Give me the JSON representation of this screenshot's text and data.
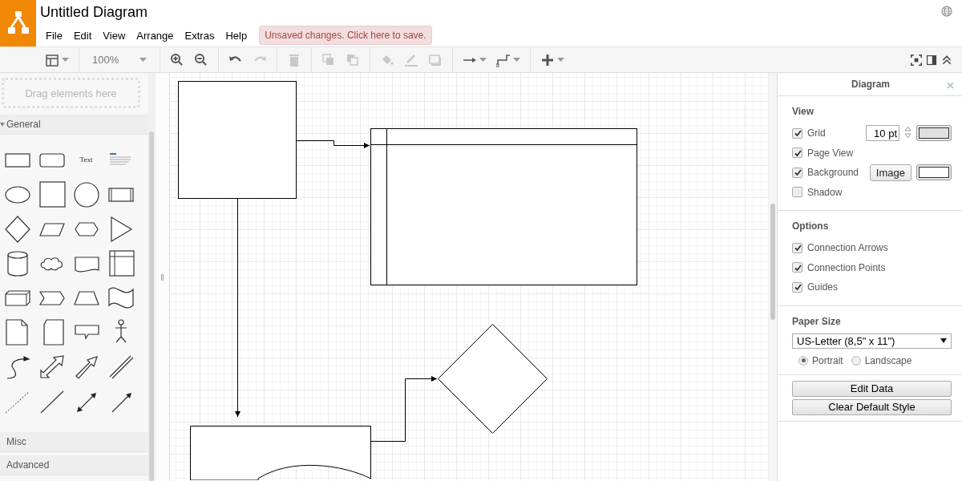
{
  "header": {
    "title": "Untitled Diagram",
    "menu": [
      "File",
      "Edit",
      "View",
      "Arrange",
      "Extras",
      "Help"
    ],
    "save_notice": "Unsaved changes. Click here to save."
  },
  "toolbar": {
    "zoom_level": "100%",
    "buttons": [
      {
        "kind": "layout",
        "disabled": false
      },
      {
        "kind": "zoom",
        "disabled": false
      },
      {
        "kind": "zoom-in",
        "disabled": false
      },
      {
        "kind": "zoom-out",
        "disabled": false
      },
      {
        "kind": "undo",
        "disabled": false
      },
      {
        "kind": "redo",
        "disabled": true
      },
      {
        "kind": "delete",
        "disabled": true
      },
      {
        "kind": "to-front",
        "disabled": true
      },
      {
        "kind": "to-back",
        "disabled": true
      },
      {
        "kind": "fill",
        "disabled": true
      },
      {
        "kind": "line",
        "disabled": true
      },
      {
        "kind": "shadow",
        "disabled": true
      },
      {
        "kind": "connection",
        "disabled": false
      },
      {
        "kind": "waypoint",
        "disabled": false
      },
      {
        "kind": "insert",
        "disabled": false
      }
    ],
    "right_buttons": [
      {
        "kind": "fit"
      },
      {
        "kind": "panel"
      },
      {
        "kind": "collapse"
      }
    ]
  },
  "sidebar": {
    "drop_hint": "Drag elements here",
    "sections": [
      {
        "title": "General",
        "expanded": true,
        "shapes": [
          {
            "kind": "rect"
          },
          {
            "kind": "rounded"
          },
          {
            "kind": "text",
            "label": "Text"
          },
          {
            "kind": "textbox"
          },
          {
            "kind": "ellipse"
          },
          {
            "kind": "square"
          },
          {
            "kind": "circle"
          },
          {
            "kind": "process"
          },
          {
            "kind": "diamond"
          },
          {
            "kind": "parallelogram"
          },
          {
            "kind": "hexagon"
          },
          {
            "kind": "triangle"
          },
          {
            "kind": "cylinder"
          },
          {
            "kind": "cloud"
          },
          {
            "kind": "document"
          },
          {
            "kind": "internal-storage"
          },
          {
            "kind": "cube"
          },
          {
            "kind": "step"
          },
          {
            "kind": "trapezoid"
          },
          {
            "kind": "tape"
          },
          {
            "kind": "note"
          },
          {
            "kind": "card"
          },
          {
            "kind": "callout"
          },
          {
            "kind": "actor"
          },
          {
            "kind": "curve"
          },
          {
            "kind": "double-arrow"
          },
          {
            "kind": "arrow"
          },
          {
            "kind": "link"
          },
          {
            "kind": "dashed-line"
          },
          {
            "kind": "line"
          },
          {
            "kind": "double-connector"
          },
          {
            "kind": "connector"
          }
        ]
      },
      {
        "title": "Misc",
        "expanded": false
      },
      {
        "title": "Advanced",
        "expanded": false
      }
    ]
  },
  "panel": {
    "title": "Diagram",
    "sections": [
      {
        "title": "View",
        "rows": [
          {
            "kind": "grid",
            "label": "Grid",
            "checked": true,
            "value": "10 pt"
          },
          {
            "kind": "check",
            "label": "Page View",
            "checked": true
          },
          {
            "kind": "background",
            "label": "Background",
            "checked": true,
            "button": "Image"
          },
          {
            "kind": "check",
            "label": "Shadow",
            "checked": false
          }
        ]
      },
      {
        "title": "Options",
        "rows": [
          {
            "kind": "check",
            "label": "Connection Arrows",
            "checked": true
          },
          {
            "kind": "check",
            "label": "Connection Points",
            "checked": true
          },
          {
            "kind": "check",
            "label": "Guides",
            "checked": true
          }
        ]
      },
      {
        "title": "Paper Size",
        "select": "US-Letter (8,5\" x 11\")",
        "orientations": [
          {
            "label": "Portrait",
            "selected": true
          },
          {
            "label": "Landscape",
            "selected": false
          }
        ]
      }
    ],
    "buttons": [
      "Edit Data",
      "Clear Default Style"
    ]
  }
}
